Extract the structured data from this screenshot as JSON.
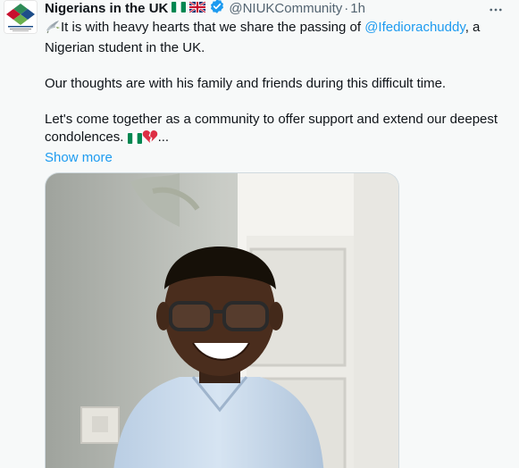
{
  "tweet": {
    "author": {
      "display_name": "Nigerians in the UK",
      "handle": "@NIUKCommunity",
      "separator": "·",
      "time": "1h",
      "avatar_text": "NIGERIANS IN UNITED KINGDOM"
    },
    "body": {
      "line1_prefix": "It is with heavy hearts that we share the passing of ",
      "mention": "@Ifediorachuddy",
      "line1_suffix": ", a Nigerian student in the UK.",
      "paragraph2": "Our thoughts are with his family and friends during this difficult time.",
      "paragraph3": "Let's come together as a community to offer support and extend our deepest condolences.",
      "ellipsis": "...",
      "show_more": "Show more"
    },
    "icons": {
      "flag": "nigeria-flag-icon",
      "uk_flag": "uk-flag-icon",
      "verified": "verified-badge-icon",
      "dove": "dove-icon",
      "broken_heart": "broken-heart-icon",
      "more": "more-options-icon"
    },
    "colors": {
      "link": "#1d9bf0",
      "secondary_text": "#536471",
      "verified": "#1d9bf0",
      "flag_green": "#008751"
    }
  }
}
